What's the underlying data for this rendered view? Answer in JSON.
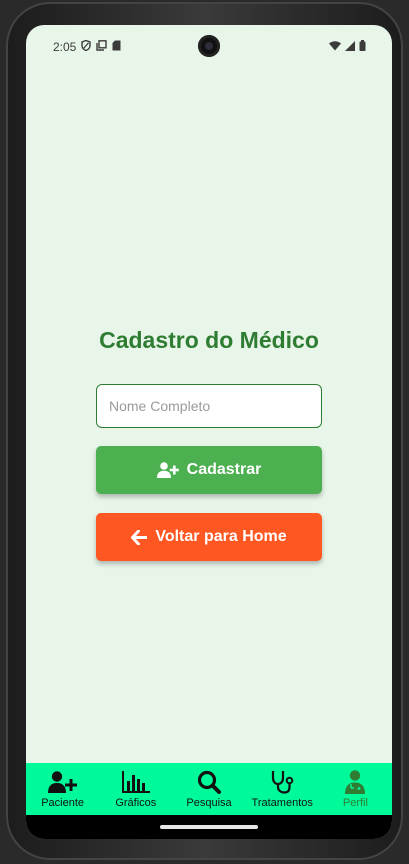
{
  "status_bar": {
    "time": "2:05"
  },
  "page": {
    "title": "Cadastro do Médico"
  },
  "form": {
    "name_placeholder": "Nome Completo",
    "name_value": ""
  },
  "buttons": {
    "register_label": "Cadastrar",
    "register_icon": "user-plus-icon",
    "back_label": "Voltar para Home",
    "back_icon": "arrow-left-icon"
  },
  "bottom_nav": {
    "items": [
      {
        "label": "Paciente",
        "icon": "user-plus-icon"
      },
      {
        "label": "Gráficos",
        "icon": "bar-chart-icon"
      },
      {
        "label": "Pesquisa",
        "icon": "search-icon"
      },
      {
        "label": "Tratamentos",
        "icon": "stethoscope-icon"
      },
      {
        "label": "Perfil",
        "icon": "doctor-icon",
        "active": true
      }
    ]
  },
  "colors": {
    "background": "#e8f5e9",
    "title": "#2e7d32",
    "register_button": "#4caf50",
    "back_button": "#ff5722",
    "nav_background": "#00fa9a",
    "active_nav": "#2e7d32"
  }
}
